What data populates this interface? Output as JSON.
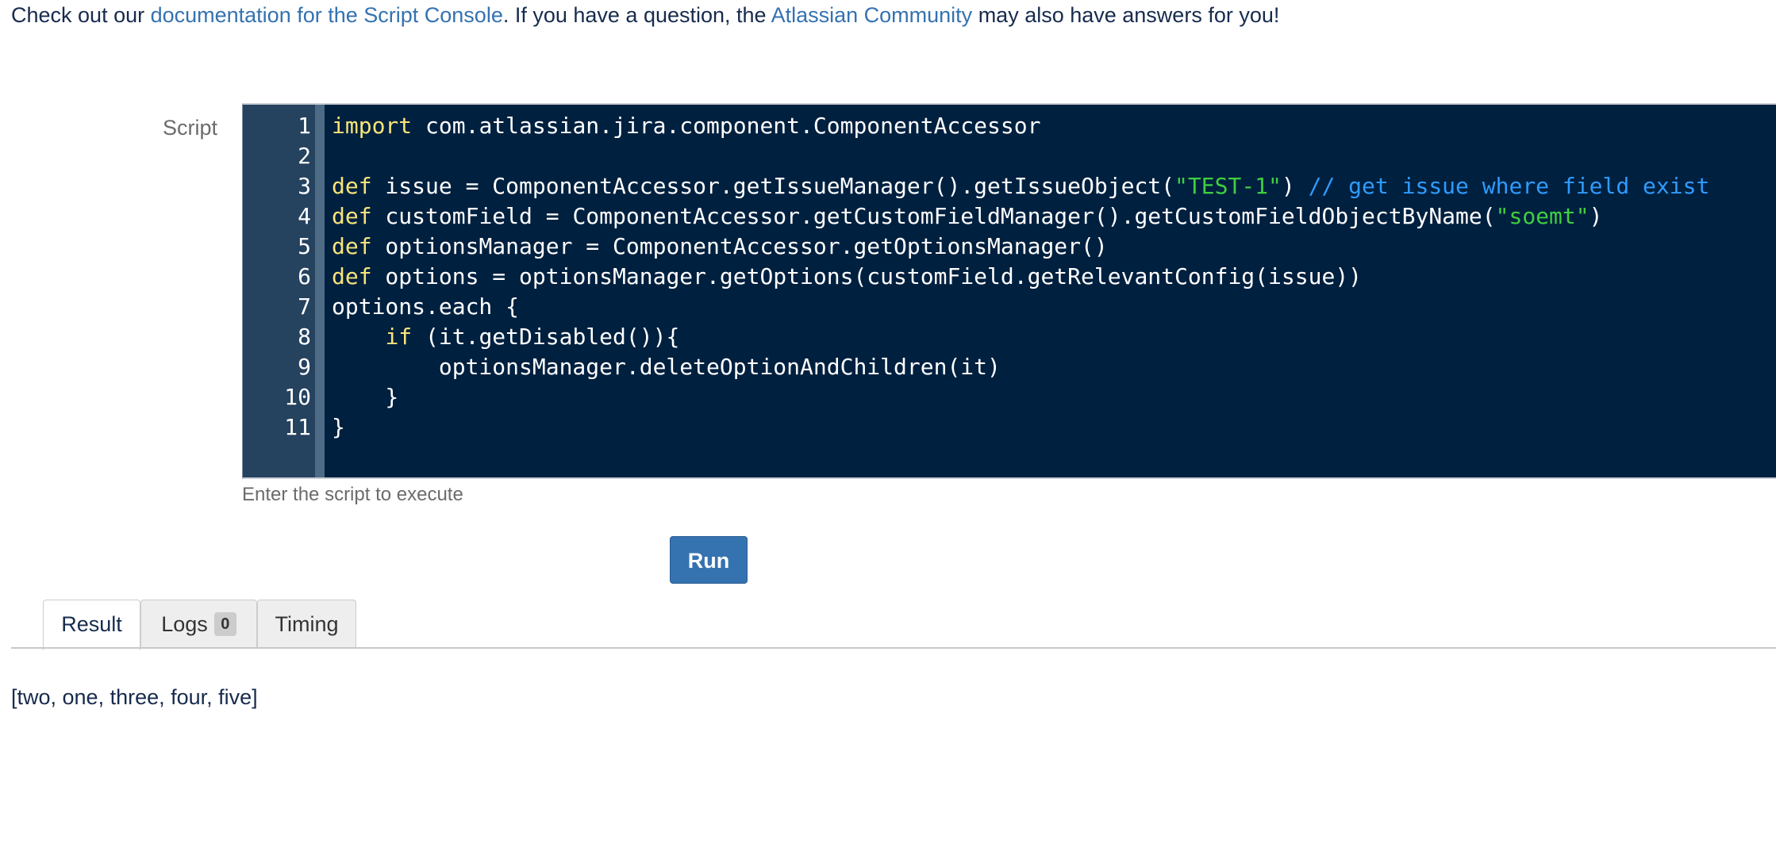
{
  "intro": {
    "prefix": "Check out our ",
    "doc_link": "documentation for the Script Console",
    "middle": ". If you have a question, the ",
    "community_link": "Atlassian Community",
    "suffix": " may also have answers for you!"
  },
  "script": {
    "label": "Script",
    "hint": "Enter the script to execute",
    "line_numbers": [
      "1",
      "2",
      "3",
      "4",
      "5",
      "6",
      "7",
      "8",
      "9",
      "10",
      "11"
    ],
    "lines": [
      [
        {
          "t": "kw",
          "v": "import"
        },
        {
          "t": "plain",
          "v": " com.atlassian.jira.component.ComponentAccessor"
        }
      ],
      [],
      [
        {
          "t": "kw",
          "v": "def"
        },
        {
          "t": "plain",
          "v": " issue = ComponentAccessor.getIssueManager().getIssueObject("
        },
        {
          "t": "str",
          "v": "\"TEST-1\""
        },
        {
          "t": "plain",
          "v": ") "
        },
        {
          "t": "cmt",
          "v": "// get issue where field exist"
        }
      ],
      [
        {
          "t": "kw",
          "v": "def"
        },
        {
          "t": "plain",
          "v": " customField = ComponentAccessor.getCustomFieldManager().getCustomFieldObjectByName("
        },
        {
          "t": "str",
          "v": "\"soemt\""
        },
        {
          "t": "plain",
          "v": ")"
        }
      ],
      [
        {
          "t": "kw",
          "v": "def"
        },
        {
          "t": "plain",
          "v": " optionsManager = ComponentAccessor.getOptionsManager()"
        }
      ],
      [
        {
          "t": "kw",
          "v": "def"
        },
        {
          "t": "plain",
          "v": " options = optionsManager.getOptions(customField.getRelevantConfig(issue))"
        }
      ],
      [
        {
          "t": "plain",
          "v": "options.each {"
        }
      ],
      [
        {
          "t": "plain",
          "v": "    "
        },
        {
          "t": "kw",
          "v": "if"
        },
        {
          "t": "plain",
          "v": " (it.getDisabled()){"
        }
      ],
      [
        {
          "t": "plain",
          "v": "        optionsManager.deleteOptionAndChildren(it)"
        }
      ],
      [
        {
          "t": "plain",
          "v": "    }"
        }
      ],
      [
        {
          "t": "plain",
          "v": "}"
        }
      ]
    ]
  },
  "run_button": {
    "label": "Run"
  },
  "tabs": [
    {
      "label": "Result",
      "active": true
    },
    {
      "label": "Logs",
      "badge": "0",
      "active": false
    },
    {
      "label": "Timing",
      "active": false
    }
  ],
  "result": {
    "output": "[two, one, three, four, five]"
  },
  "colors": {
    "editor_background": "#00203f",
    "keyword": "#f7e479",
    "string": "#3fcf3f",
    "comment": "#2e9bff",
    "link": "#3572b0",
    "button": "#3572b0"
  }
}
